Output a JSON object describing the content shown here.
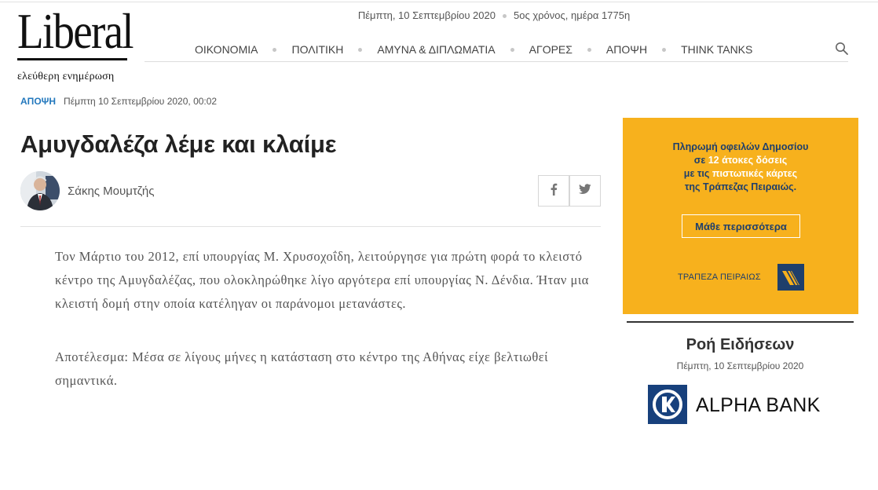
{
  "brand": {
    "logo_word": "Liberal",
    "tagline": "ελεύθερη ενημέρωση"
  },
  "datebar": {
    "date": "Πέμπτη, 10 Σεπτεμβρίου 2020",
    "year_info": "5ος χρόνος, ημέρα 1775η"
  },
  "nav": {
    "items": [
      "ΟΙΚΟΝΟΜΙΑ",
      "ΠΟΛΙΤΙΚΗ",
      "ΑΜΥΝΑ & ΔΙΠΛΩΜΑΤΙΑ",
      "ΑΓΟΡΕΣ",
      "ΑΠΟΨΗ",
      "THINK TANKS"
    ],
    "search_icon": "search-icon"
  },
  "article": {
    "category": "ΑΠΟΨΗ",
    "datetime": "Πέμπτη 10 Σεπτεμβρίου 2020, 00:02",
    "title": "Αμυγδαλέζα λέμε και κλαίμε",
    "author": "Σάκης Μουμτζής",
    "share_icons": [
      "facebook-icon",
      "twitter-icon"
    ],
    "paragraphs": [
      "Τον Μάρτιο του 2012, επί υπουργίας Μ. Χρυσοχοΐδη, λειτούργησε για πρώτη φορά το κλειστό κέντρο της Αμυγδαλέζας, που ολοκληρώθηκε λίγο αργότερα επί υπουργίας Ν. Δένδια. Ήταν μια κλειστή δομή στην οποία κατέληγαν οι παράνομοι μετανάστες.",
      "Αποτέλεσμα: Μέσα σε λίγους μήνες η κατάσταση στο κέντρο της Αθήνας είχε βελτιωθεί σημαντικά."
    ]
  },
  "ad": {
    "line1": "Πληρωμή οφειλών Δημοσίου",
    "line2_pre": "σε ",
    "line2_bold": "12 άτοκες δόσεις",
    "line3_pre": "με τις ",
    "line3_bold": "πιστωτικές κάρτες",
    "line4": "της Τράπεζας Πειραιώς.",
    "cta": "Μάθε περισσότερα",
    "bank": "ΤΡΑΠΕΖΑ ΠΕΙΡΑΙΩΣ",
    "color": "#f7b11d",
    "text_color": "#1f3f6b"
  },
  "sidebar": {
    "news_title": "Ροή Ειδήσεων",
    "news_date": "Πέμπτη, 10 Σεπτεμβρίου 2020",
    "sponsor": "ALPHA BANK"
  }
}
